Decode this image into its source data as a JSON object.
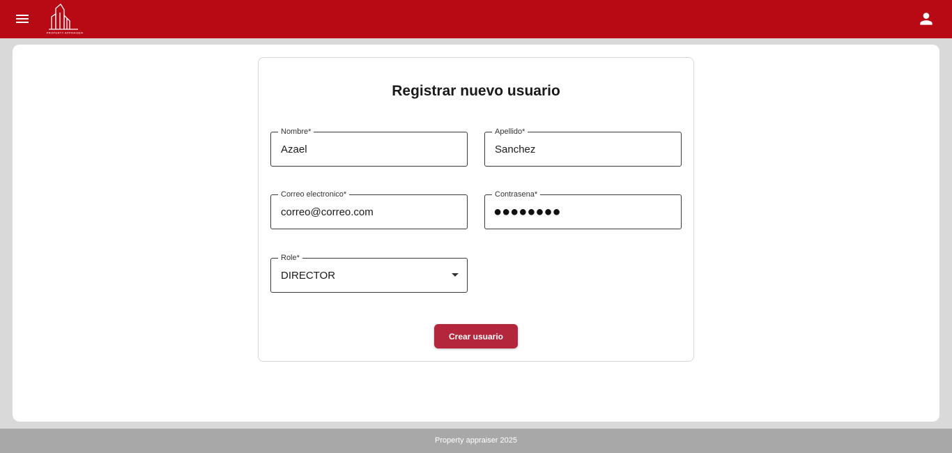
{
  "header": {
    "menu_icon": "menu-icon",
    "logo_text": "PROPERTY APPRAISER",
    "user_icon": "person-icon",
    "color": "#b80a14"
  },
  "form": {
    "title": "Registrar nuevo usuario",
    "fields": {
      "nombre": {
        "label": "Nombre*",
        "value": "Azael"
      },
      "apellido": {
        "label": "Apellido*",
        "value": "Sanchez"
      },
      "correo": {
        "label": "Correo electronico*",
        "value": "correo@correo.com"
      },
      "contrasena": {
        "label": "Contrasena*",
        "value": "●●●●●●●●"
      },
      "role": {
        "label": "Role*",
        "value": "DIRECTOR"
      }
    },
    "submit_label": "Crear usuario",
    "submit_color": "#b3263b"
  },
  "footer": {
    "text": "Property appraiser 2025"
  }
}
